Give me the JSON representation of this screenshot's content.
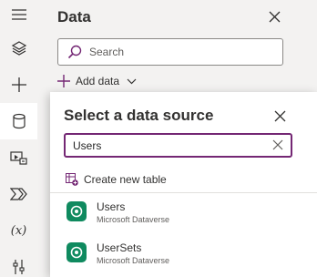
{
  "rail": {
    "items": [
      {
        "name": "menu-icon"
      },
      {
        "name": "layers-icon"
      },
      {
        "name": "plus-icon"
      },
      {
        "name": "database-icon",
        "active": true
      },
      {
        "name": "media-icon"
      },
      {
        "name": "power-automate-icon"
      },
      {
        "name": "formula-icon",
        "text": "(x)"
      },
      {
        "name": "tools-icon"
      }
    ]
  },
  "data_pane": {
    "title": "Data",
    "search_placeholder": "Search",
    "add_data_label": "Add data"
  },
  "popup": {
    "title": "Select a data source",
    "search_value": "Users",
    "create_table_label": "Create new table",
    "results": [
      {
        "name": "Users",
        "source": "Microsoft Dataverse"
      },
      {
        "name": "UserSets",
        "source": "Microsoft Dataverse"
      }
    ]
  },
  "colors": {
    "accent": "#742774",
    "dataverse_green": "#0f8a5f",
    "pane_background": "#f3f2f1"
  }
}
